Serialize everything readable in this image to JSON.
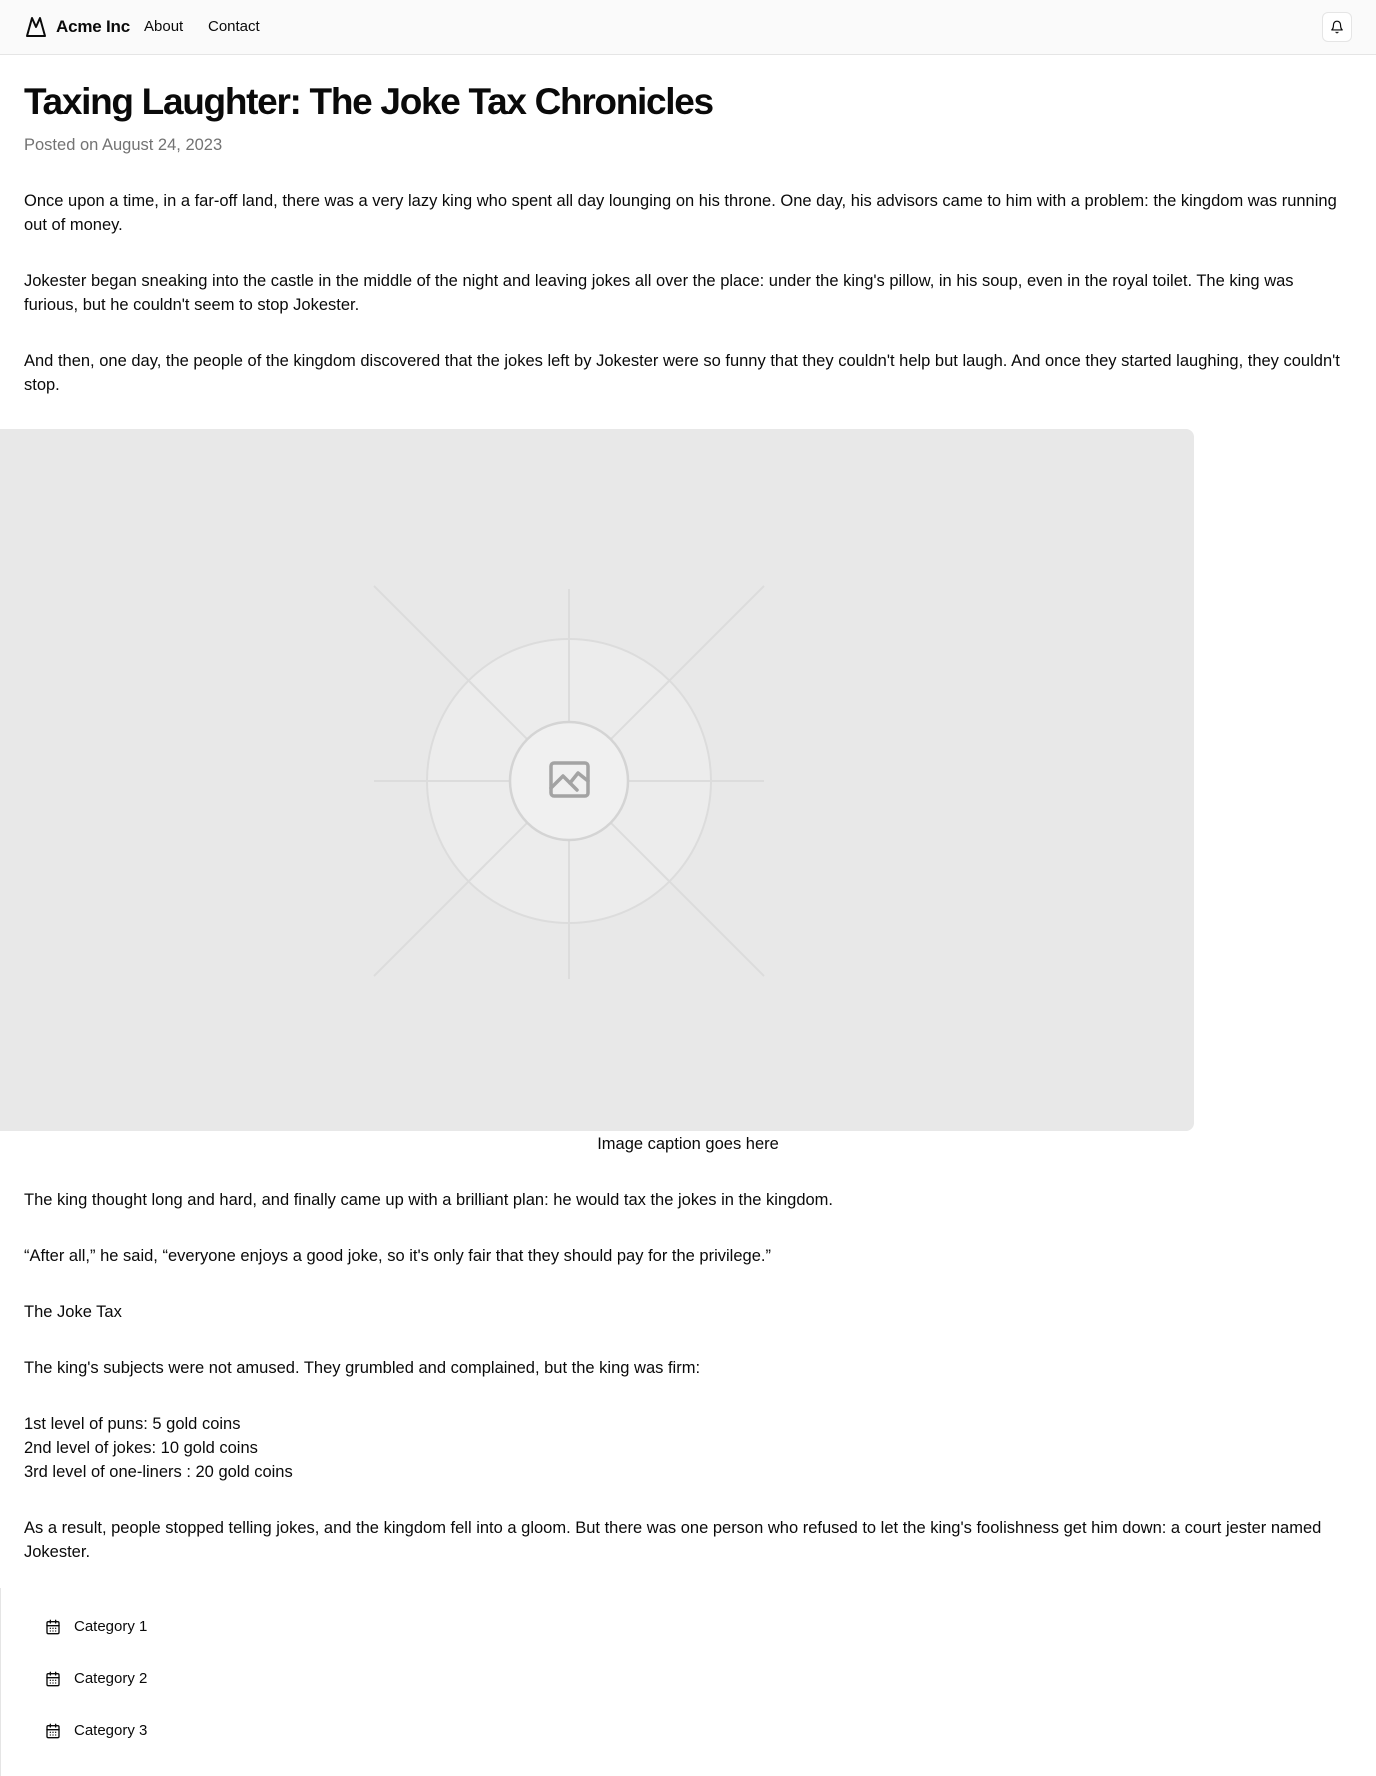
{
  "header": {
    "brand": "Acme Inc",
    "nav": [
      "About",
      "Contact"
    ]
  },
  "article": {
    "title": "Taxing Laughter: The Joke Tax Chronicles",
    "posted": "Posted on August 24, 2023",
    "intro": [
      "Once upon a time, in a far-off land, there was a very lazy king who spent all day lounging on his throne. One day, his advisors came to him with a problem: the kingdom was running out of money.",
      "Jokester began sneaking into the castle in the middle of the night and leaving jokes all over the place: under the king's pillow, in his soup, even in the royal toilet. The king was furious, but he couldn't seem to stop Jokester.",
      "And then, one day, the people of the kingdom discovered that the jokes left by Jokester were so funny that they couldn't help but laugh. And once they started laughing, they couldn't stop."
    ],
    "caption": "Image caption goes here",
    "body": [
      "The king thought long and hard, and finally came up with a brilliant plan: he would tax the jokes in the kingdom.",
      "“After all,” he said, “everyone enjoys a good joke, so it's only fair that they should pay for the privilege.”",
      "The Joke Tax",
      "The king's subjects were not amused. They grumbled and complained, but the king was firm:"
    ],
    "tax_levels": [
      "1st level of puns: 5 gold coins",
      "2nd level of jokes: 10 gold coins",
      "3rd level of one-liners : 20 gold coins"
    ],
    "closing": "As a result, people stopped telling jokes, and the kingdom fell into a gloom. But there was one person who refused to let the king's foolishness get him down: a court jester named Jokester."
  },
  "categories": [
    "Category 1",
    "Category 2",
    "Category 3"
  ],
  "icons": {
    "brand": "mountain-icon",
    "notifications": "bell-icon",
    "image": "image-placeholder-icon",
    "category": "calendar-icon"
  }
}
